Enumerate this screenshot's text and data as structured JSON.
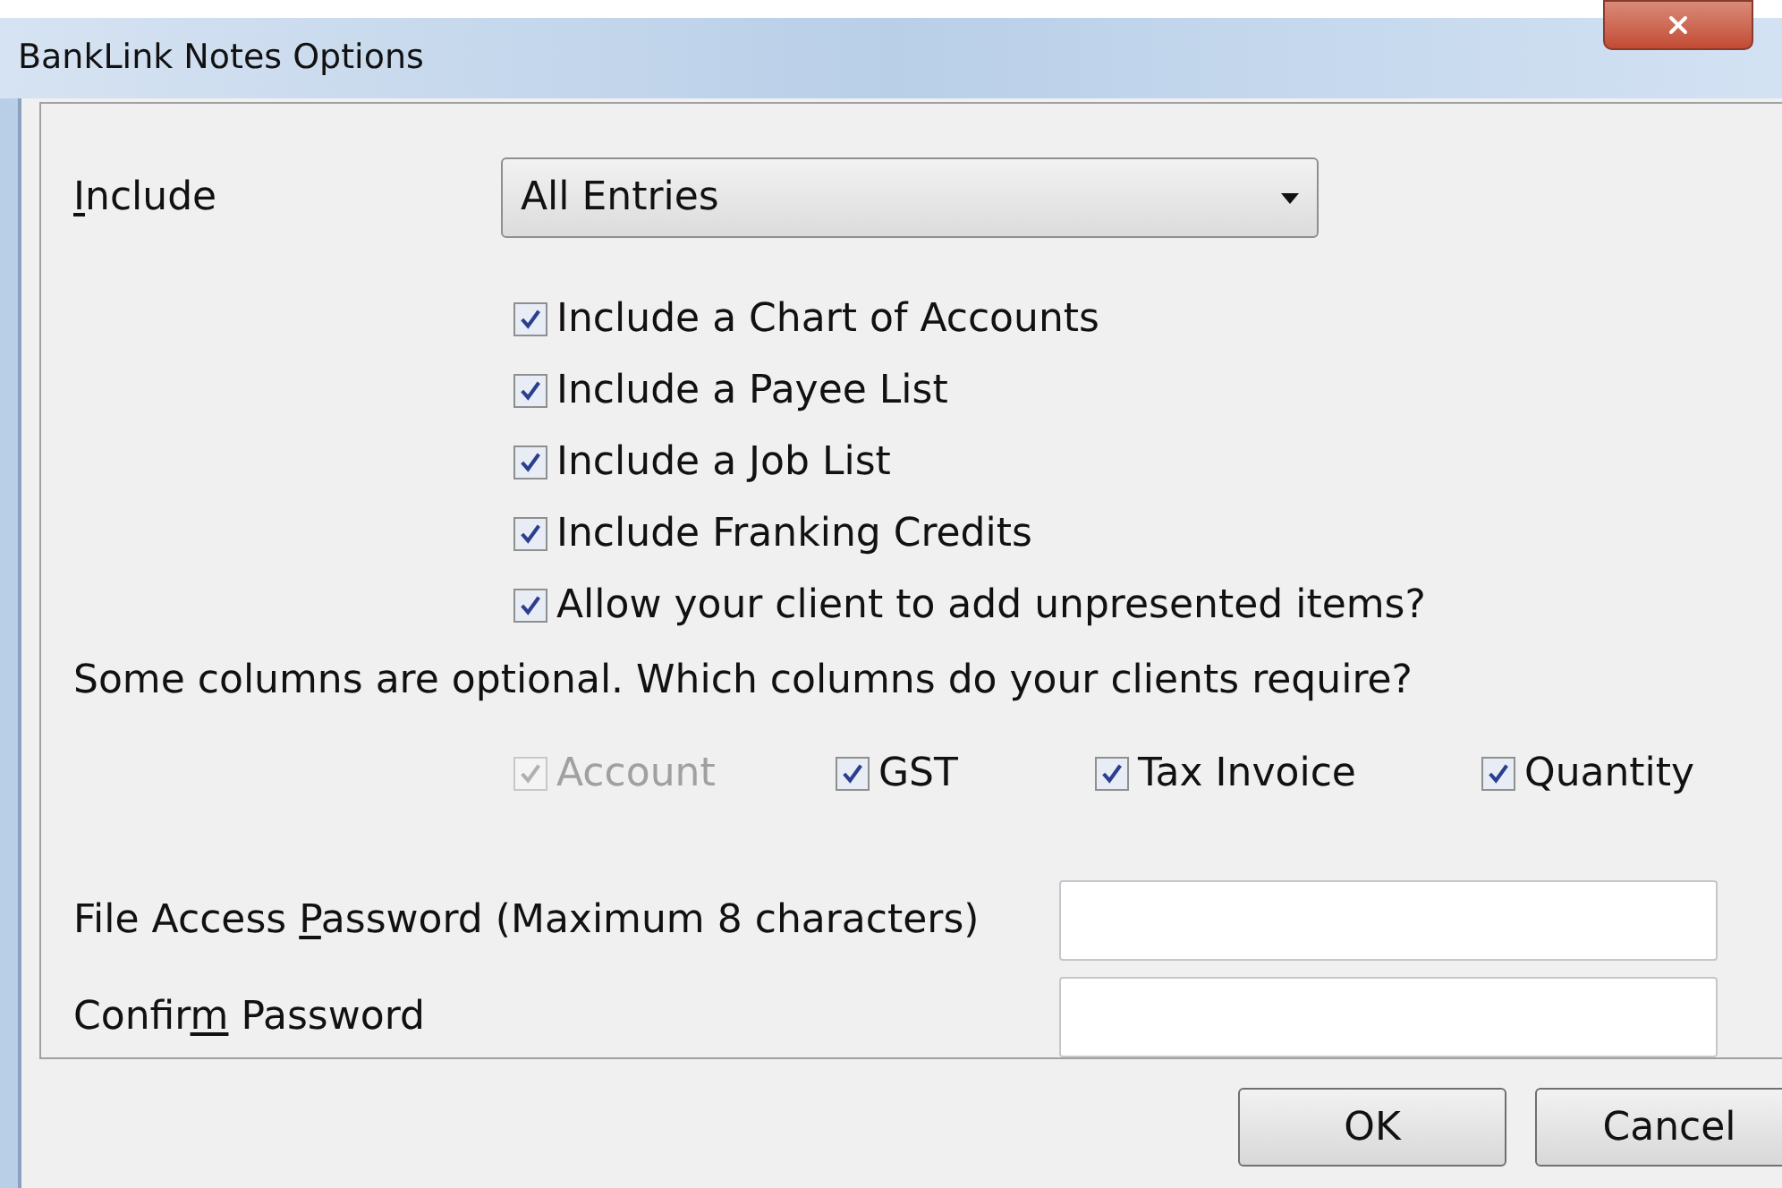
{
  "window": {
    "title": "BankLink Notes Options"
  },
  "include": {
    "label": {
      "key": "I",
      "after": "nclude"
    },
    "value": "All Entries"
  },
  "options": [
    {
      "label": "Include a Chart of Accounts",
      "checked": true
    },
    {
      "label": "Include a Payee List",
      "checked": true
    },
    {
      "label": "Include a Job List",
      "checked": true
    },
    {
      "label": "Include Franking Credits",
      "checked": true
    },
    {
      "label": "Allow your client to add unpresented items?",
      "checked": true
    }
  ],
  "columns_prompt": "Some columns are optional. Which columns do your clients require?",
  "columns": [
    {
      "label": "Account",
      "checked": true,
      "disabled": true
    },
    {
      "label": "GST",
      "checked": true,
      "disabled": false
    },
    {
      "label": "Tax Invoice",
      "checked": true,
      "disabled": false
    },
    {
      "label": "Quantity",
      "checked": true,
      "disabled": false
    }
  ],
  "password_fields": [
    {
      "label": {
        "before": "File Access ",
        "key": "P",
        "after": "assword (Maximum 8 characters)"
      }
    },
    {
      "label": {
        "before": "Confir",
        "key": "m",
        "after": " Password"
      }
    }
  ],
  "buttons": [
    "OK",
    "Cancel"
  ]
}
